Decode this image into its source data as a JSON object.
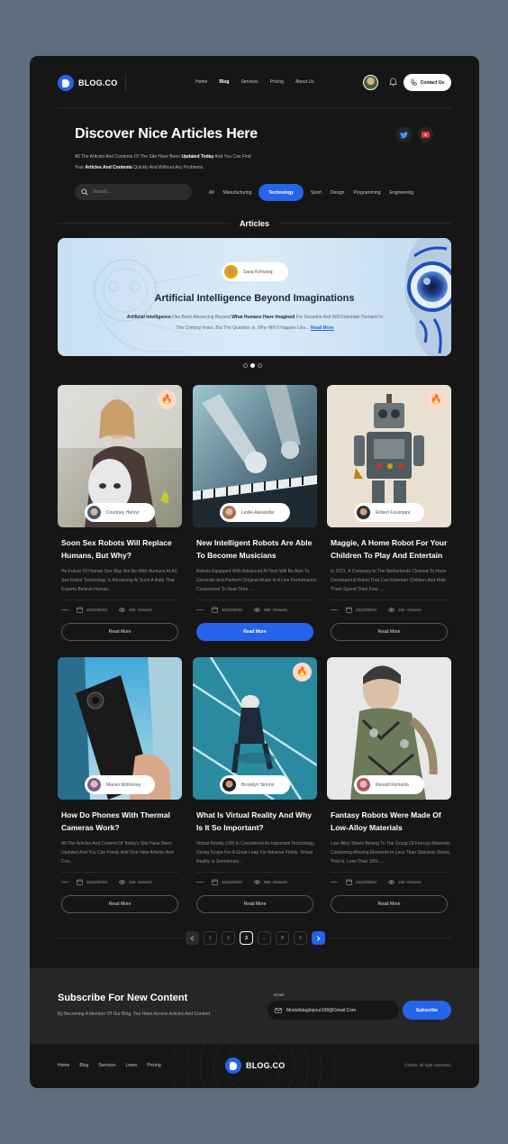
{
  "nav": {
    "brand": "BLOG.CO",
    "menu": [
      "Home",
      "Blog",
      "Services",
      "Pricing",
      "About Us"
    ],
    "active_menu": "Blog",
    "contact_label": "Contact Us"
  },
  "hero": {
    "title": "Discover Nice Articles Here",
    "desc_line1_a": "All The Articles And Contents Of The Site Have Been ",
    "desc_line1_b": "Updated Today",
    "desc_line1_c": " And You Can Find",
    "desc_line2_a": "Your ",
    "desc_line2_b": "Articles And Contents",
    "desc_line2_c": " Quickly And Without Any Problems.",
    "search_placeholder": "Search...",
    "categories": [
      "All",
      "Manufacturing",
      "Technology",
      "Sport",
      "Design",
      "Programming",
      "Engineering"
    ],
    "active_category": "Technology"
  },
  "section_title": "Articles",
  "featured": {
    "author": "Saraj Kohyseg",
    "title": "Artificial Intelligence Beyond Imaginations",
    "desc_a": "Artificial Intelligence",
    "desc_b": " Has Been Advancing Beyond ",
    "desc_c": "What Humans Have Imagined",
    "desc_d": " For Decades And Will Dominate Humans In",
    "desc_e": "The Coming Years, But The Question Is, Why Will It Happen Like... ",
    "read_more": "Read More",
    "slide_count": 3,
    "active_slide": 2
  },
  "articles": [
    {
      "author": "Courtney Henryr",
      "title": "Soon Sex Robots Will Replace Humans, But Why?",
      "desc": "He Future Of Human Sex May Not Be With Humans At All. Sex Robot Technology Is Advancing At Such A Rate That Experts Believe Human...",
      "date": "2022/09/23",
      "views": "10K Viewers",
      "button": "Read More",
      "hot": true,
      "highlight": false
    },
    {
      "author": "Leslie Alexander",
      "title": "New Intelligent Robots Are Able To Become Musicians",
      "desc": "Robots Equipped With Advanced AI Tech Will Be Able To Generate And Perform Original Music In A Live Performance Customized To Real-Time ...",
      "date": "2022/09/23",
      "views": "98K Viewers",
      "button": "Read More",
      "hot": false,
      "highlight": true
    },
    {
      "author": "Robert Foxsmani",
      "title": "Maggie, A Home Robot For Your Children To Play And Entertain",
      "desc": "In 2021, A Company In The Netherlands Claimed To Have Developed A Robot That Can Entertain Children And Help Them Spend Their Free ...",
      "date": "2022/09/23",
      "views": "10K Viewers",
      "button": "Read More",
      "hot": true,
      "highlight": false
    },
    {
      "author": "Marvin McKinney",
      "title": "How Do Phones With Thermal Cameras Work?",
      "desc": "All The Articles And Content Of Today's Site Have Been Updated And You Can Freely Add Your New Articles And Con...",
      "date": "2022/09/23",
      "views": "10K Viewers",
      "button": "Read More",
      "hot": false,
      "highlight": false
    },
    {
      "author": "Brooklyn Simmo",
      "title": "What Is Virtual Reality And Why Is It So Important?",
      "desc": "Virtual Reality (VR) Is Considered As Important Technology, Giving Scope For A Great Leap For Adverse Fields. Virtual Reality Is Sometimes...",
      "date": "2022/09/23",
      "views": "98K Viewers",
      "button": "Read More",
      "hot": true,
      "highlight": false
    },
    {
      "author": "Ronald Richards",
      "title": "Fantasy Robots Were Made Of Low-Alloy Materials",
      "desc": "Low-Alloy Steels Belong To The Group Of Ferrous Materials Containing Alloying Elements In Less Than Stainless Steels, That Is, Less Than 10% ...",
      "date": "2022/09/23",
      "views": "10K Viewers",
      "button": "Read More",
      "hot": false,
      "highlight": false
    }
  ],
  "pagination": {
    "pages": [
      "1",
      "2",
      "3",
      "...",
      "8",
      "9"
    ],
    "current": "3"
  },
  "subscribe": {
    "title": "Subscribe For New Content",
    "desc": "By Becoming A Member Of Our Blog, You Have Access Articles And Content",
    "email_label": "Email",
    "email_value": "Mostafataghipour108@Gmail.Com",
    "button": "Subscribe"
  },
  "footer": {
    "menu": [
      "Home",
      "Blog",
      "Services",
      "Learn",
      "Pricing"
    ],
    "brand": "BLOG.CO",
    "copyright": "©2022, All right reserved."
  },
  "colors": {
    "accent": "#2563eb",
    "background": "#161616",
    "page": "#5f6e7e",
    "banner": "#d9ebf7"
  }
}
